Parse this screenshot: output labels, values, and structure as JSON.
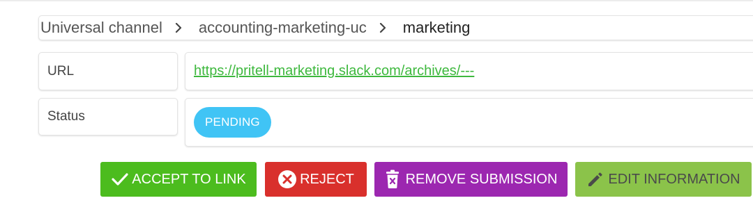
{
  "breadcrumb": {
    "items": [
      "Universal channel",
      "accounting-marketing-uc",
      "marketing"
    ]
  },
  "fields": {
    "url": {
      "label": "URL",
      "value": "https://pritell-marketing.slack.com/archives/---"
    },
    "status": {
      "label": "Status",
      "value": "PENDING"
    }
  },
  "actions": {
    "accept": "ACCEPT TO LINK",
    "reject": "REJECT",
    "remove": "REMOVE SUBMISSION",
    "edit": "EDIT INFORMATION"
  },
  "colors": {
    "accept": "#4cbc1e",
    "reject": "#d9302c",
    "remove": "#9c27b0",
    "edit": "#8bc34a",
    "status_badge": "#40c4f5",
    "link": "#3db83d"
  },
  "icons": {
    "breadcrumb_separator": "chevron-right-icon",
    "accept": "check-icon",
    "reject": "close-circle-icon",
    "remove": "trash-icon",
    "edit": "pencil-icon"
  }
}
